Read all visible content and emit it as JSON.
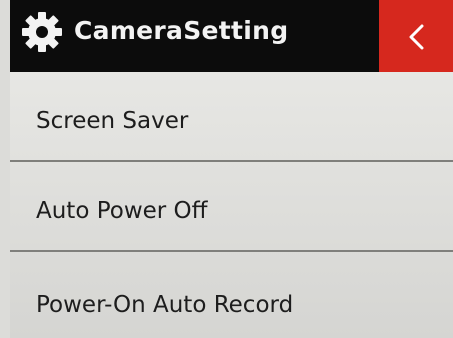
{
  "header": {
    "title": "CameraSetting",
    "icon": "gear-icon",
    "back_icon": "chevron-left-icon",
    "colors": {
      "background": "#0c0c0c",
      "back_button": "#d6281e",
      "title": "#f3f3f3"
    }
  },
  "menu": {
    "items": [
      {
        "label": "Screen Saver"
      },
      {
        "label": "Auto Power Off"
      },
      {
        "label": "Power-On Auto Record"
      }
    ]
  }
}
